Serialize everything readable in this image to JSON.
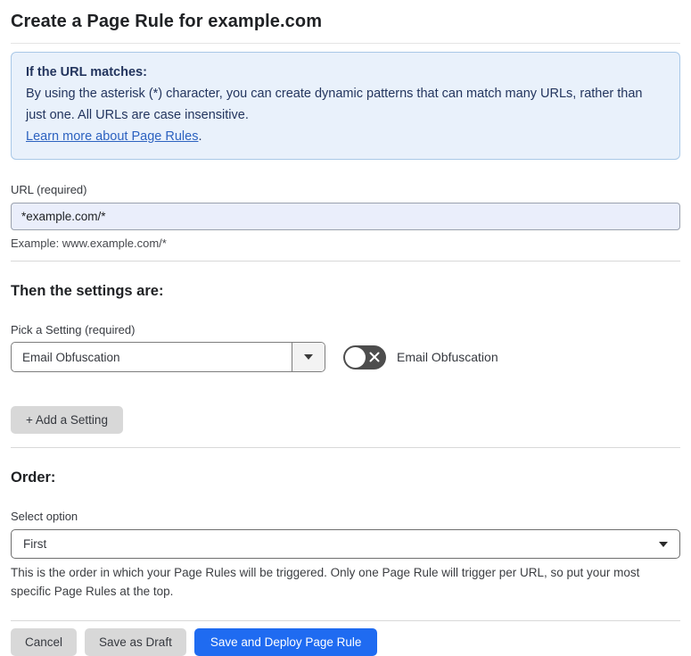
{
  "page": {
    "title": "Create a Page Rule for example.com"
  },
  "info_box": {
    "heading": "If the URL matches:",
    "body": "By using the asterisk (*) character, you can create dynamic patterns that can match many URLs, rather than just one. All URLs are case insensitive.",
    "link_label": "Learn more about Page Rules",
    "link_suffix": "."
  },
  "url_field": {
    "label": "URL (required)",
    "value": "*example.com/*",
    "helper": "Example: www.example.com/*"
  },
  "settings_section": {
    "heading": "Then the settings are:",
    "picker_label": "Pick a Setting (required)",
    "picker_value": "Email Obfuscation",
    "picker_arrow_icon": "caret-down-icon",
    "toggle_label": "Email Obfuscation",
    "toggle_state": "off",
    "toggle_off_icon": "x-icon",
    "add_setting_label": "+ Add a Setting"
  },
  "order_section": {
    "heading": "Order:",
    "select_label": "Select option",
    "select_value": "First",
    "select_arrow_icon": "caret-down-icon",
    "helper": "This is the order in which your Page Rules will be triggered. Only one Page Rule will trigger per URL, so put your most specific Page Rules at the top."
  },
  "footer": {
    "cancel_label": "Cancel",
    "save_draft_label": "Save as Draft",
    "save_deploy_label": "Save and Deploy Page Rule"
  },
  "colors": {
    "info_bg": "#e9f1fb",
    "info_border": "#a9c8e7",
    "info_text": "#23355e",
    "link_blue": "#2c62c0",
    "input_bg": "#eaeefb",
    "primary_button_blue": "#1f6bf1",
    "gray_button": "#d8d8d8",
    "toggle_off_bg": "#4d4d4d"
  }
}
